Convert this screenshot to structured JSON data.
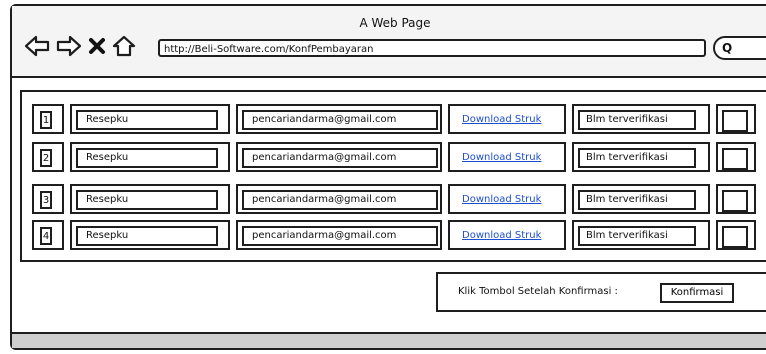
{
  "window": {
    "title": "A Web Page"
  },
  "browser": {
    "url": "http://Beli-Software.com/KonfPembayaran",
    "search_icon_text": "Q"
  },
  "table": {
    "rows": [
      {
        "num": "1",
        "name": "Resepku",
        "email": "pencariandarma@gmail.com",
        "link": "Download Struk",
        "status": "Blm terverifikasi"
      },
      {
        "num": "2",
        "name": "Resepku",
        "email": "pencariandarma@gmail.com",
        "link": "Download Struk",
        "status": "Blm terverifikasi"
      },
      {
        "num": "3",
        "name": "Resepku",
        "email": "pencariandarma@gmail.com",
        "link": "Download Struk",
        "status": "Blm terverifikasi"
      },
      {
        "num": "4",
        "name": "Resepku",
        "email": "pencariandarma@gmail.com",
        "link": "Download Struk",
        "status": "Blm terverifikasi"
      }
    ]
  },
  "confirm": {
    "label": "Klik Tombol Setelah Konfirmasi :",
    "button": "Konfirmasi"
  },
  "colors": {
    "link": "#1f4fd1",
    "statusbar": "#cfcfcf"
  }
}
